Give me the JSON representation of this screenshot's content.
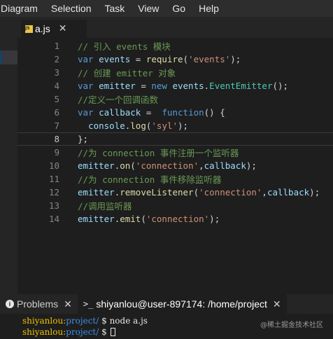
{
  "menubar": {
    "items": [
      {
        "label": "Diagram"
      },
      {
        "label": "Selection"
      },
      {
        "label": "Task"
      },
      {
        "label": "View"
      },
      {
        "label": "Go"
      },
      {
        "label": "Help"
      }
    ]
  },
  "editor_tab": {
    "filename": "a.js",
    "icon": "js-file-icon",
    "close": "✕"
  },
  "editor": {
    "active_line": 8,
    "lines": [
      {
        "num": "1",
        "tokens": [
          {
            "t": "// 引入 events 模块",
            "c": "comment"
          }
        ]
      },
      {
        "num": "2",
        "tokens": [
          {
            "t": "var",
            "c": "kw"
          },
          {
            "t": " ",
            "c": "punc"
          },
          {
            "t": "events",
            "c": "var"
          },
          {
            "t": " = ",
            "c": "punc"
          },
          {
            "t": "require",
            "c": "fn"
          },
          {
            "t": "(",
            "c": "punc"
          },
          {
            "t": "'events'",
            "c": "str"
          },
          {
            "t": ");",
            "c": "punc"
          }
        ]
      },
      {
        "num": "3",
        "tokens": [
          {
            "t": "// 创建 emitter 对象",
            "c": "comment"
          }
        ]
      },
      {
        "num": "4",
        "tokens": [
          {
            "t": "var",
            "c": "kw"
          },
          {
            "t": " ",
            "c": "punc"
          },
          {
            "t": "emitter",
            "c": "var"
          },
          {
            "t": " = ",
            "c": "punc"
          },
          {
            "t": "new",
            "c": "kw"
          },
          {
            "t": " ",
            "c": "punc"
          },
          {
            "t": "events",
            "c": "var"
          },
          {
            "t": ".",
            "c": "punc"
          },
          {
            "t": "EventEmitter",
            "c": "cls"
          },
          {
            "t": "();",
            "c": "punc"
          }
        ]
      },
      {
        "num": "5",
        "tokens": [
          {
            "t": "//定义一个回调函数",
            "c": "comment"
          }
        ]
      },
      {
        "num": "6",
        "tokens": [
          {
            "t": "var",
            "c": "kw"
          },
          {
            "t": " ",
            "c": "punc"
          },
          {
            "t": "callback",
            "c": "var"
          },
          {
            "t": " =  ",
            "c": "punc"
          },
          {
            "t": "function",
            "c": "kw"
          },
          {
            "t": "() {",
            "c": "punc"
          }
        ]
      },
      {
        "num": "7",
        "tokens": [
          {
            "t": "  ",
            "c": "punc"
          },
          {
            "t": "console",
            "c": "var"
          },
          {
            "t": ".",
            "c": "punc"
          },
          {
            "t": "log",
            "c": "fn"
          },
          {
            "t": "(",
            "c": "punc"
          },
          {
            "t": "'syl'",
            "c": "str"
          },
          {
            "t": ");",
            "c": "punc"
          }
        ]
      },
      {
        "num": "8",
        "tokens": [
          {
            "t": "};",
            "c": "punc"
          }
        ]
      },
      {
        "num": "9",
        "tokens": [
          {
            "t": "//为 connection 事件注册一个监听器",
            "c": "comment"
          }
        ]
      },
      {
        "num": "10",
        "tokens": [
          {
            "t": "emitter",
            "c": "var"
          },
          {
            "t": ".",
            "c": "punc"
          },
          {
            "t": "on",
            "c": "fn"
          },
          {
            "t": "(",
            "c": "punc"
          },
          {
            "t": "'connection'",
            "c": "str"
          },
          {
            "t": ",",
            "c": "punc"
          },
          {
            "t": "callback",
            "c": "var"
          },
          {
            "t": ");",
            "c": "punc"
          }
        ]
      },
      {
        "num": "11",
        "tokens": [
          {
            "t": "//为 connection 事件移除监听器",
            "c": "comment"
          }
        ]
      },
      {
        "num": "12",
        "tokens": [
          {
            "t": "emitter",
            "c": "var"
          },
          {
            "t": ".",
            "c": "punc"
          },
          {
            "t": "removeListener",
            "c": "fn"
          },
          {
            "t": "(",
            "c": "punc"
          },
          {
            "t": "'connection'",
            "c": "str"
          },
          {
            "t": ",",
            "c": "punc"
          },
          {
            "t": "callback",
            "c": "var"
          },
          {
            "t": ");",
            "c": "punc"
          }
        ]
      },
      {
        "num": "13",
        "tokens": [
          {
            "t": "//调用监听器",
            "c": "comment"
          }
        ]
      },
      {
        "num": "14",
        "tokens": [
          {
            "t": "emitter",
            "c": "var"
          },
          {
            "t": ".",
            "c": "punc"
          },
          {
            "t": "emit",
            "c": "fn"
          },
          {
            "t": "(",
            "c": "punc"
          },
          {
            "t": "'connection'",
            "c": "str"
          },
          {
            "t": ");",
            "c": "punc"
          }
        ]
      }
    ]
  },
  "panel": {
    "problems_label": "Problems",
    "problems_icon": "info-icon",
    "terminal_label": "shiyanlou@user-897174: /home/project",
    "terminal_icon": "terminal-icon",
    "close": "✕"
  },
  "terminal": {
    "lines": [
      {
        "user": "shiyanlou:",
        "path": "project/",
        "prompt": " $ ",
        "cmd": "node a.js",
        "cursor": false
      },
      {
        "user": "shiyanlou:",
        "path": "project/",
        "prompt": " $ ",
        "cmd": "",
        "cursor": true
      }
    ]
  },
  "watermark": "@稀土掘金技术社区",
  "colors": {
    "comment": "#6a9955",
    "keyword": "#569cd6",
    "variable": "#9cdcfe",
    "function": "#dcdcaa",
    "string": "#ce9178",
    "class": "#4ec9b0",
    "terminal_user": "#f0c000",
    "terminal_path": "#3b8eea"
  }
}
